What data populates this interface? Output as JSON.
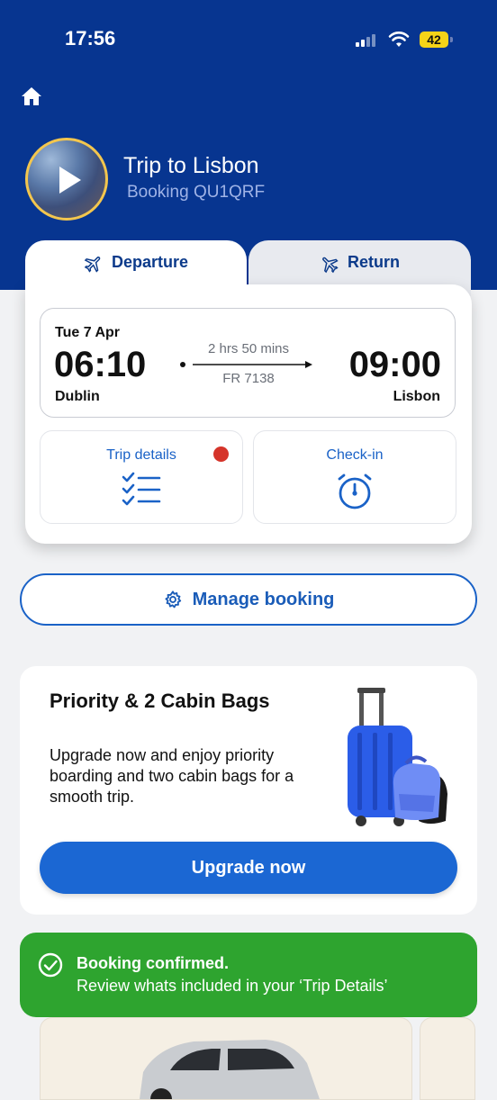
{
  "status_bar": {
    "time": "17:56",
    "battery": "42"
  },
  "trip": {
    "title": "Trip to Lisbon",
    "booking": "Booking QU1QRF"
  },
  "tabs": [
    {
      "label": "Departure",
      "active": true
    },
    {
      "label": "Return",
      "active": false
    }
  ],
  "flight": {
    "date": "Tue 7 Apr",
    "departure_time": "06:10",
    "arrival_time": "09:00",
    "origin": "Dublin",
    "destination": "Lisbon",
    "duration": "2 hrs 50 mins",
    "flight_number": "FR 7138"
  },
  "actions": {
    "trip_details": "Trip details",
    "check_in": "Check-in"
  },
  "manage_booking": "Manage booking",
  "promo": {
    "title": "Priority & 2 Cabin Bags",
    "text": "Upgrade now and enjoy priority boarding and two cabin bags for a smooth trip.",
    "button": "Upgrade now"
  },
  "toast": {
    "title": "Booking confirmed.",
    "text": "Review whats included in your ‘Trip Details’"
  },
  "colors": {
    "header": "#073590",
    "accent": "#1b67d3",
    "success": "#2ea42f",
    "alert_dot": "#d5342a",
    "battery": "#f5d318"
  },
  "icons": [
    "home-icon",
    "play-icon",
    "plane-icon",
    "checklist-icon",
    "stopwatch-icon",
    "gear-icon",
    "check-circle-icon",
    "suitcase-icon",
    "car-icon"
  ]
}
